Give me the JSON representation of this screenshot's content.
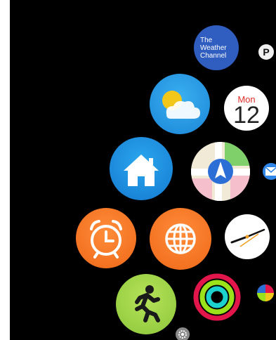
{
  "apps": {
    "weather_channel": {
      "name": "The Weather Channel"
    },
    "weather": {
      "name": "weather-icon"
    },
    "calendar": {
      "day_of_week": "Mon",
      "day": "12"
    },
    "home": {
      "name": "home-icon"
    },
    "maps": {
      "name": "maps-icon"
    },
    "mail": {
      "name": "mail-icon"
    },
    "alarm": {
      "name": "alarm-clock-icon"
    },
    "world_clock": {
      "name": "globe-icon"
    },
    "clock": {
      "name": "clock-icon"
    },
    "workout": {
      "name": "running-man-icon"
    },
    "activity": {
      "name": "activity-rings-icon"
    },
    "passbook": {
      "label": "P"
    },
    "settings": {
      "name": "gear-icon"
    }
  }
}
